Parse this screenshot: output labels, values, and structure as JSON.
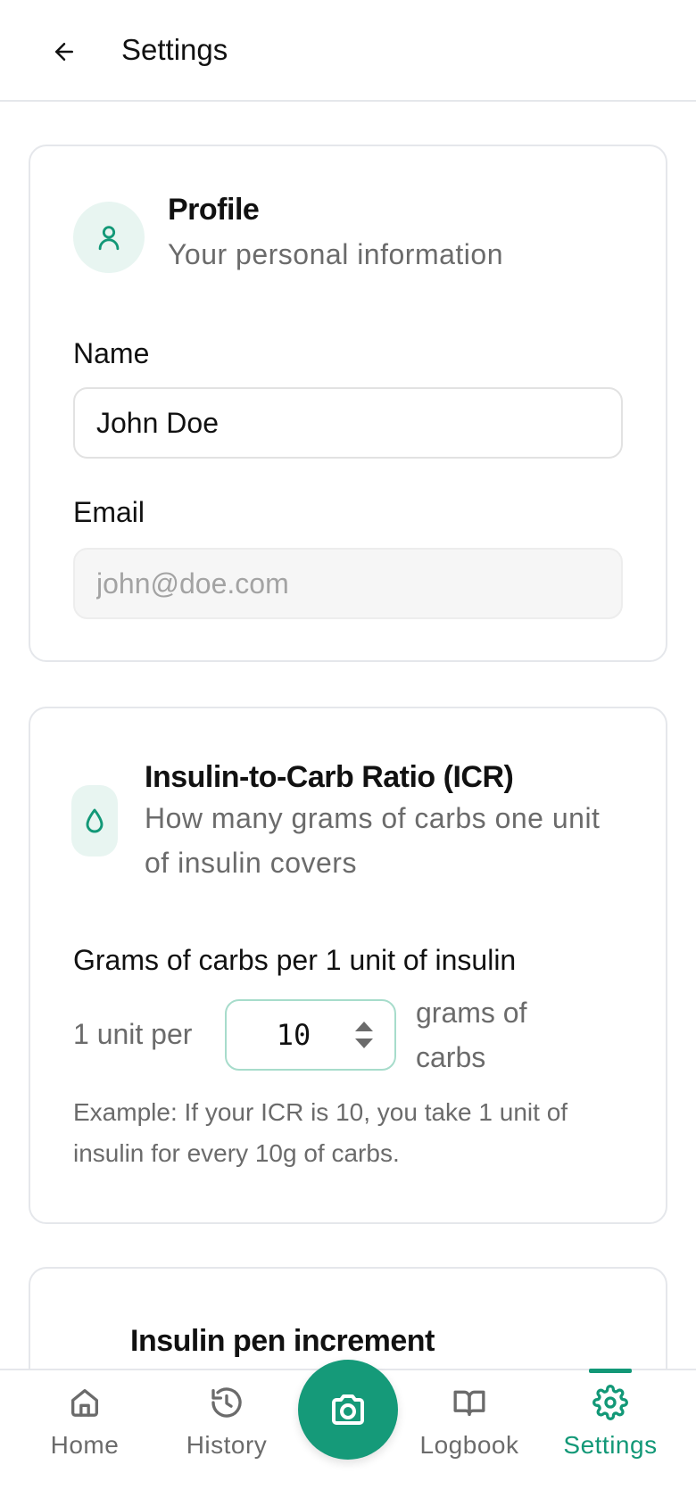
{
  "header": {
    "title": "Settings",
    "back_icon": "arrow-left-icon"
  },
  "profile": {
    "title": "Profile",
    "subtitle": "Your personal information",
    "icon": "user-icon",
    "name_label": "Name",
    "name_value": "John Doe",
    "email_label": "Email",
    "email_placeholder": "john@doe.com"
  },
  "icr": {
    "title": "Insulin-to-Carb Ratio (ICR)",
    "subtitle": "How many grams of carbs one unit of insulin covers",
    "icon": "droplet-icon",
    "field_label": "Grams of carbs per 1 unit of insulin",
    "prefix": "1 unit per",
    "value": "10",
    "suffix": "grams of carbs",
    "example": "Example: If your ICR is 10, you take 1 unit of insulin for every 10g of carbs."
  },
  "pen": {
    "title": "Insulin pen increment"
  },
  "nav": {
    "items": [
      {
        "label": "Home",
        "icon": "home-icon"
      },
      {
        "label": "History",
        "icon": "history-icon"
      },
      {
        "label": "Logbook",
        "icon": "book-icon"
      },
      {
        "label": "Settings",
        "icon": "gear-icon"
      }
    ],
    "fab_icon": "camera-icon",
    "active": "Settings",
    "accent_color": "#129877"
  }
}
